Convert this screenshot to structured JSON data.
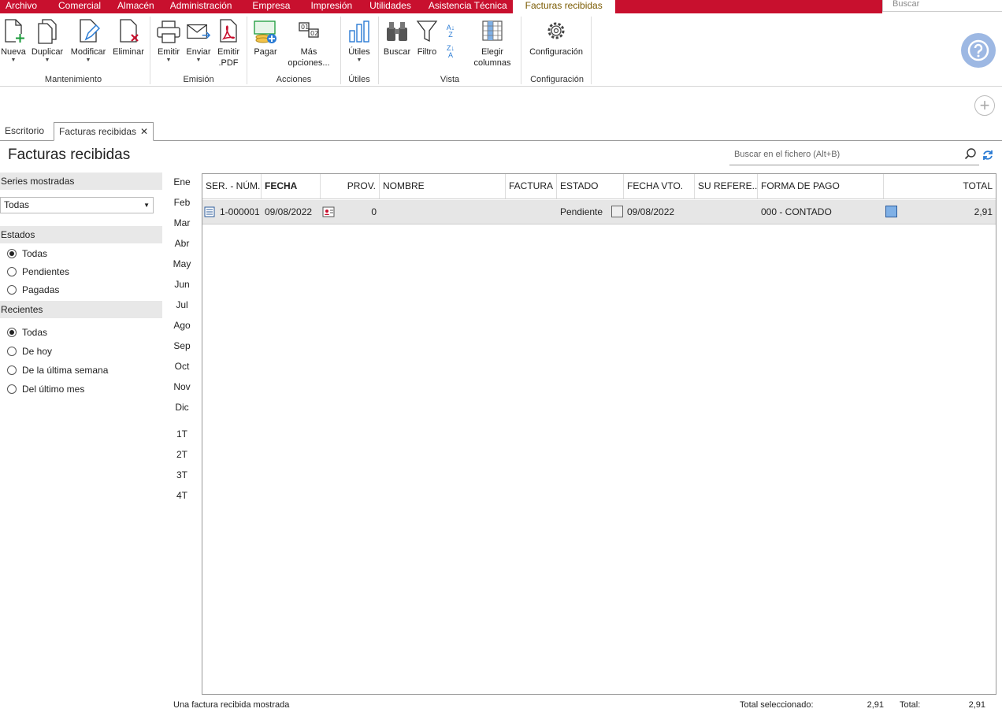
{
  "menu": {
    "items": [
      "Archivo",
      "Comercial",
      "Almacén",
      "Administración",
      "Empresa",
      "Impresión",
      "Utilidades",
      "Asistencia Técnica",
      "Facturas recibidas"
    ],
    "search_placeholder": "Buscar"
  },
  "ribbon": {
    "nueva": "Nueva",
    "duplicar": "Duplicar",
    "modificar": "Modificar",
    "eliminar": "Eliminar",
    "emitir": "Emitir",
    "enviar": "Enviar",
    "emitir_pdf_1": "Emitir",
    "emitir_pdf_2": ".PDF",
    "pagar": "Pagar",
    "mas_1": "Más",
    "mas_2": "opciones...",
    "utiles": "Útiles",
    "buscar": "Buscar",
    "filtro": "Filtro",
    "elegir_1": "Elegir",
    "elegir_2": "columnas",
    "configuracion": "Configuración",
    "groups": {
      "mantenimiento": "Mantenimiento",
      "emision": "Emisión",
      "acciones": "Acciones",
      "utiles": "Útiles",
      "vista": "Vista",
      "configuracion": "Configuración"
    }
  },
  "tabs": {
    "escritorio": "Escritorio",
    "facturas": "Facturas recibidas"
  },
  "page": {
    "title": "Facturas recibidas",
    "search_placeholder": "Buscar en el fichero (Alt+B)"
  },
  "sidebar": {
    "series_header": "Series mostradas",
    "series_value": "Todas",
    "estados_header": "Estados",
    "estados": [
      "Todas",
      "Pendientes",
      "Pagadas"
    ],
    "estados_selected": "Todas",
    "recientes_header": "Recientes",
    "recientes": [
      "Todas",
      "De hoy",
      "De la última semana",
      "Del último mes"
    ],
    "recientes_selected": "Todas"
  },
  "months": [
    "Ene",
    "Feb",
    "Mar",
    "Abr",
    "May",
    "Jun",
    "Jul",
    "Ago",
    "Sep",
    "Oct",
    "Nov",
    "Dic"
  ],
  "quarters": [
    "1T",
    "2T",
    "3T",
    "4T"
  ],
  "table": {
    "columns": [
      "SER. - NÚM.",
      "FECHA",
      "",
      "PROV.",
      "NOMBRE",
      "FACTURA",
      "ESTADO",
      "FECHA VTO.",
      "SU REFERE...",
      "FORMA DE PAGO",
      "TOTAL"
    ],
    "rows": [
      {
        "ser_num": "1-000001",
        "fecha": "09/08/2022",
        "prov": "0",
        "nombre": "",
        "factura": "",
        "estado": "Pendiente",
        "fecha_vto": "09/08/2022",
        "su_ref": "",
        "forma_pago": "000 - CONTADO",
        "total": "2,91"
      }
    ]
  },
  "status": {
    "count_text": "Una factura recibida mostrada",
    "total_sel_label": "Total seleccionado:",
    "total_sel_value": "2,91",
    "total_label": "Total:",
    "total_value": "2,91"
  },
  "colors": {
    "menu_red": "#c8102e",
    "accent_blue": "#2a7bd4"
  }
}
